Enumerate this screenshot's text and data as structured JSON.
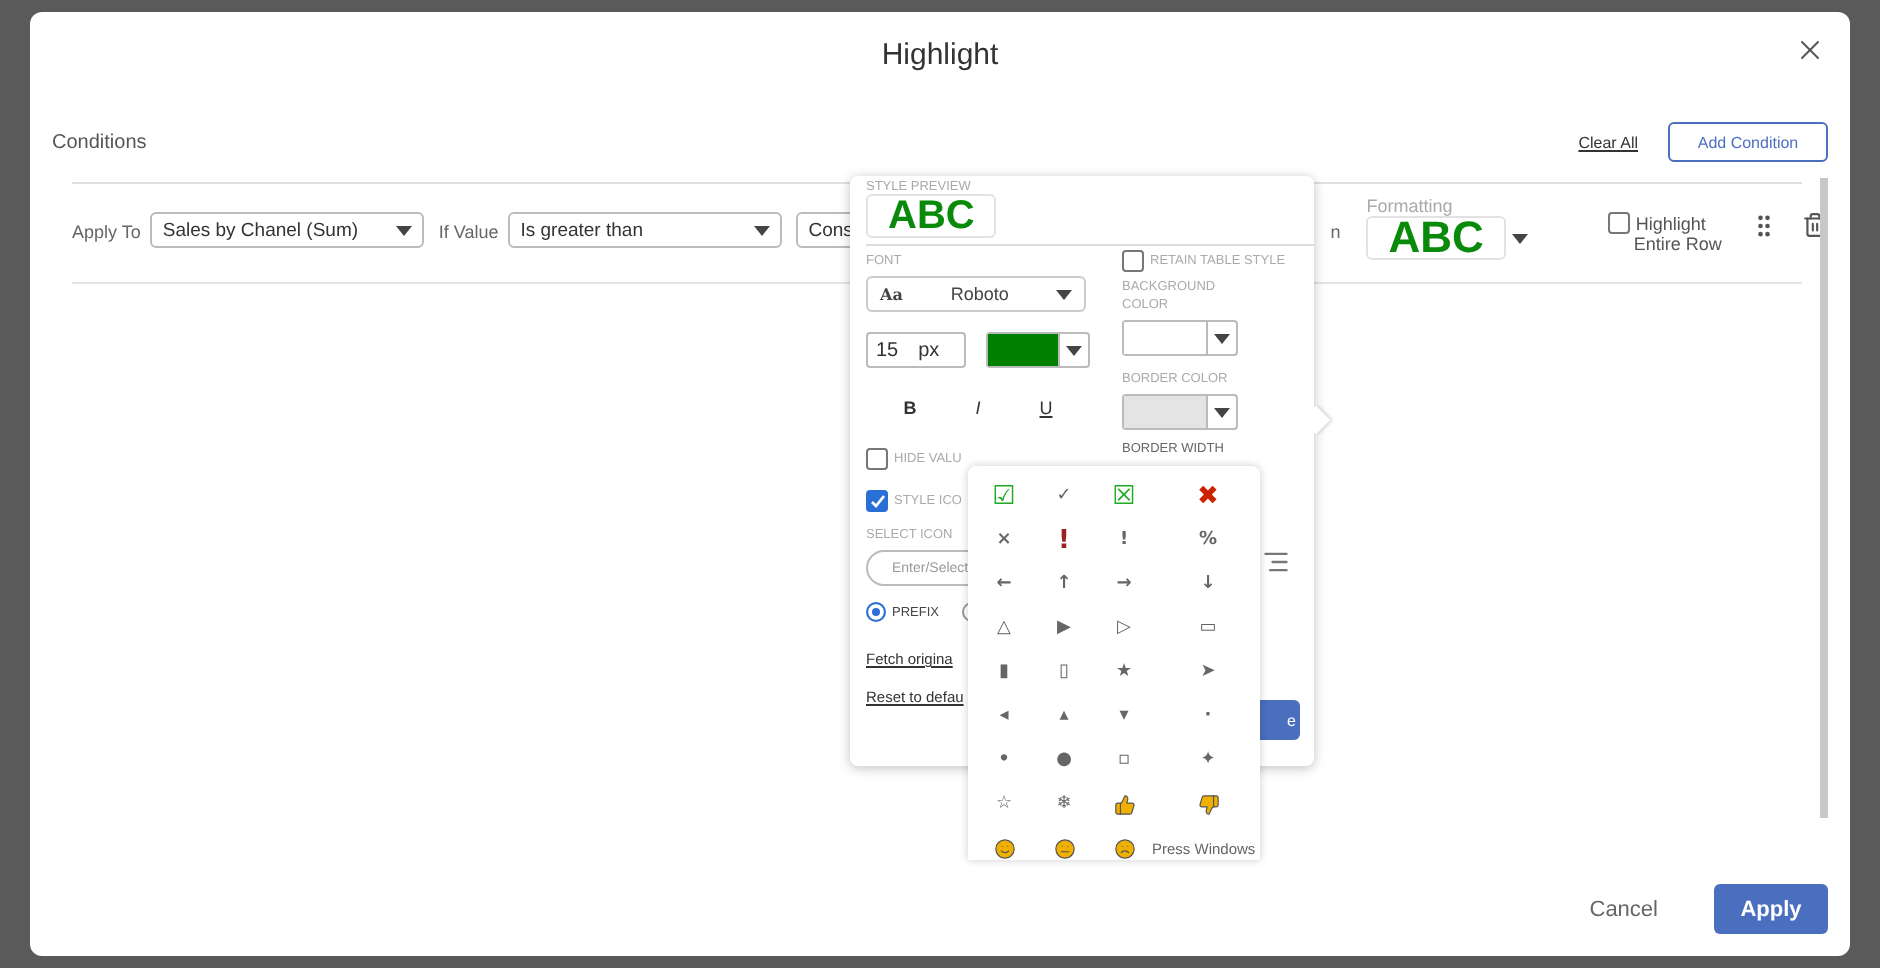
{
  "dialog": {
    "title": "Highlight"
  },
  "conditions": {
    "heading": "Conditions",
    "clear_all": "Clear All",
    "add_condition": "Add Condition"
  },
  "rule": {
    "apply_to_label": "Apply To",
    "apply_to": "Sales by Chanel (Sum)",
    "if_value_label": "If Value",
    "operator": "Is greater than",
    "compare": "Cons",
    "fragment": "n",
    "formatting_label": "Formatting",
    "preview": "ABC",
    "highlight_row": {
      "label": "Highlight",
      "label_2": "Entire Row",
      "checked": false
    }
  },
  "style_popover": {
    "preview_label": "STYLE PREVIEW",
    "preview": "ABC",
    "font_label": "FONT",
    "retain": {
      "label": "RETAIN TABLE STYLE",
      "checked": false
    },
    "font_glyph": "Aa",
    "font": "Roboto",
    "size": "15",
    "unit": "px",
    "text_color_picker": {
      "color": "#008000"
    },
    "background_label": "BACKGROUND",
    "background_label_2": "COLOR",
    "background_color_picker": {
      "color": "#ffffff"
    },
    "border_label": "BORDER COLOR",
    "border_color_picker": {
      "color": "#e4e4e4"
    },
    "bold": "B",
    "italic": "I",
    "underline": "U",
    "border_width_label": "BORDER WIDTH",
    "hide_value": {
      "label": "HIDE VALU",
      "checked": false
    },
    "style_icon": {
      "label": "STYLE ICO",
      "checked": true
    },
    "select_icons_label": "SELECT ICON",
    "icon_placeholder": "Enter/Select",
    "positions": [
      {
        "label": "PREFIX",
        "selected": true
      },
      {
        "selected": false
      }
    ],
    "fetch": "Fetch origina",
    "reset": "Reset to defau",
    "save": "e"
  },
  "icon_picker": [
    {
      "kind": "glyph",
      "text": "☑",
      "color": "#22aa22"
    },
    {
      "kind": "glyph",
      "text": "✓"
    },
    {
      "kind": "glyph",
      "text": "☒",
      "color": "#22aa22"
    },
    {
      "kind": "glyph",
      "text": "✖",
      "color": "#cc2200"
    },
    {
      "kind": "glyph",
      "text": "×"
    },
    {
      "kind": "glyph",
      "text": "!",
      "color": "#992222"
    },
    {
      "kind": "glyph",
      "text": "!"
    },
    {
      "kind": "glyph",
      "text": "%"
    },
    {
      "kind": "glyph",
      "text": "←"
    },
    {
      "kind": "glyph",
      "text": "↑"
    },
    {
      "kind": "glyph",
      "text": "→"
    },
    {
      "kind": "glyph",
      "text": "↓"
    },
    {
      "kind": "glyph",
      "text": "△"
    },
    {
      "kind": "glyph",
      "text": "▶"
    },
    {
      "kind": "glyph",
      "text": "▷"
    },
    {
      "kind": "glyph",
      "text": "▭"
    },
    {
      "kind": "glyph",
      "text": "▮"
    },
    {
      "kind": "glyph",
      "text": "▯"
    },
    {
      "kind": "glyph",
      "text": "★"
    },
    {
      "kind": "glyph",
      "text": "➤"
    },
    {
      "kind": "glyph",
      "text": "◂"
    },
    {
      "kind": "glyph",
      "text": "▴"
    },
    {
      "kind": "glyph",
      "text": "▾"
    },
    {
      "kind": "glyph",
      "text": "·"
    },
    {
      "kind": "glyph",
      "text": "•"
    },
    {
      "kind": "glyph",
      "text": "●"
    },
    {
      "kind": "glyph",
      "text": "▫"
    },
    {
      "kind": "glyph",
      "text": "✦"
    },
    {
      "kind": "glyph",
      "text": "☆"
    },
    {
      "kind": "glyph",
      "text": "❄"
    },
    {
      "kind": "thumb-up",
      "color": "#f0b000"
    },
    {
      "kind": "thumb-down",
      "color": "#f0b000"
    },
    {
      "kind": "smile",
      "color": "#f0b000"
    },
    {
      "kind": "neutral",
      "color": "#f0b000"
    },
    {
      "kind": "frown",
      "color": "#f0b000"
    },
    {
      "kind": "text",
      "text": "Press Windows"
    }
  ],
  "footer": {
    "cancel": "Cancel",
    "apply": "Apply"
  }
}
